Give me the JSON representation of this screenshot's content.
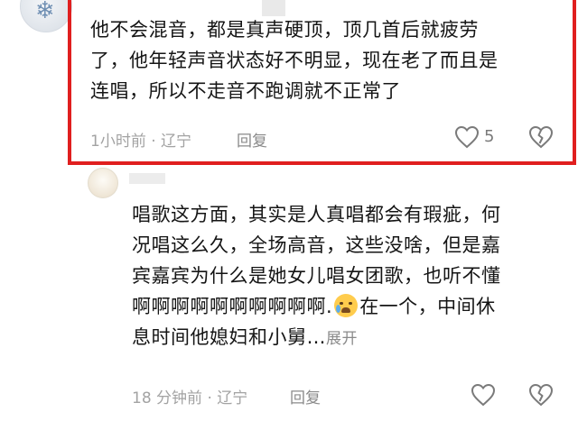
{
  "comment1": {
    "lines": [
      "他不会混音，都是真声硬顶，顶几首后就疲劳",
      "了，他年轻声音状态好不明显，现在老了而且是",
      "连唱，所以不走音不跑调就不正常了"
    ],
    "meta": "1小时前 · 辽宁",
    "reply_label": "回复",
    "like_count": "5",
    "highlight_color": "#e01f1f"
  },
  "comment2": {
    "lines": [
      "唱歌这方面，其实是人真唱都会有瑕疵，何",
      "况唱这么久，全场高音，这些没啥，但是嘉",
      "宾嘉宾为什么是她女儿唱女团歌，也听不懂"
    ],
    "line4_before_emoji": "啊啊啊啊啊啊啊啊啊啊.",
    "line4_after_emoji": "在一个，中间休",
    "line5": "息时间他媳妇和小舅…",
    "expand_label": "展开",
    "meta": "18 分钟前 · 辽宁",
    "reply_label": "回复",
    "emoji_icon": "crying-face-icon"
  }
}
